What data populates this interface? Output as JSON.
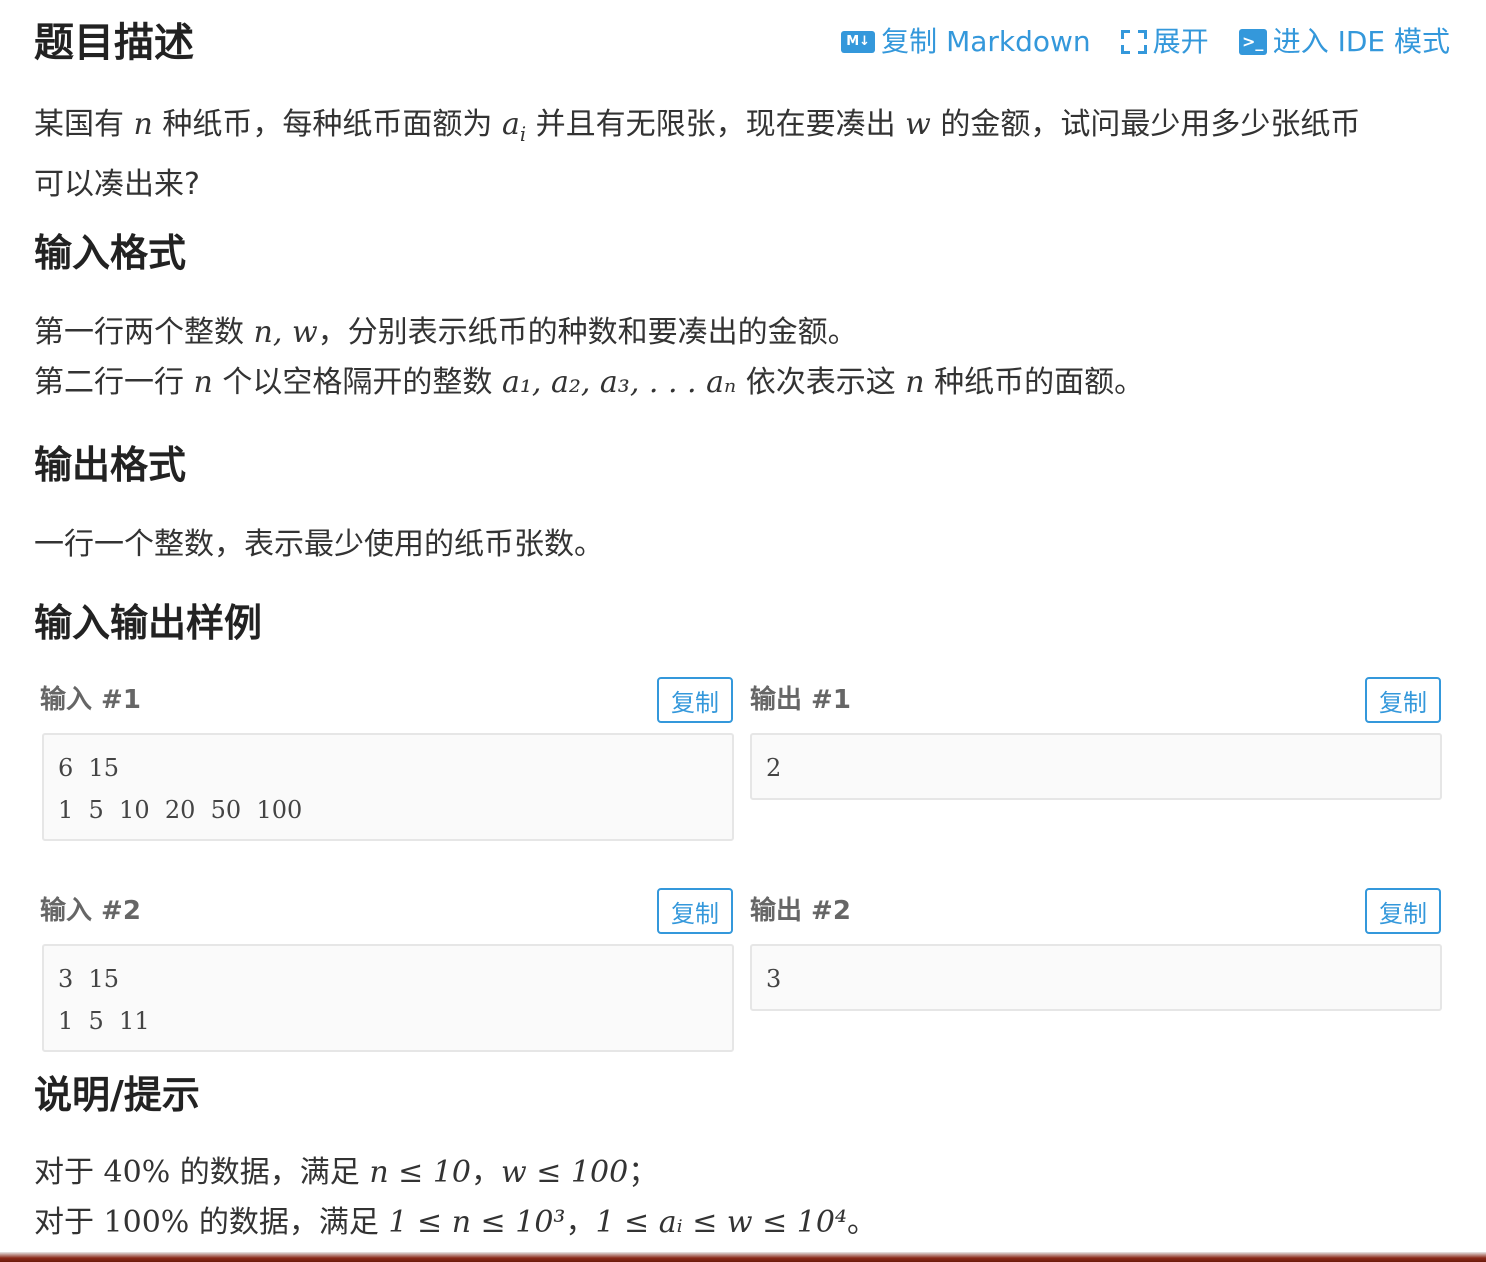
{
  "header": {
    "title": "题目描述",
    "actions": [
      {
        "icon": "markdown-icon",
        "label": "复制 Markdown"
      },
      {
        "icon": "expand-icon",
        "label": "展开"
      },
      {
        "icon": "terminal-icon",
        "label": "进入 IDE 模式"
      }
    ]
  },
  "description": {
    "p1_a": "某国有 ",
    "p1_n": "n",
    "p1_b": " 种纸币，每种纸币面额为 ",
    "p1_ai": "a",
    "p1_ai_sub": "i",
    "p1_c": " 并且有无限张，现在要凑出 ",
    "p1_w": "w",
    "p1_d": " 的金额，试问最少用多少张纸币",
    "p1_e": "可以凑出来?"
  },
  "input_format": {
    "heading": "输入格式",
    "l1_a": "第一行两个整数 ",
    "l1_math": "n, w",
    "l1_b": "，分别表示纸币的种数和要凑出的金额。",
    "l2_a": "第二行一行 ",
    "l2_n": "n",
    "l2_b": " 个以空格隔开的整数 ",
    "l2_seq": "a₁, a₂, a₃, . . . aₙ",
    "l2_c": " 依次表示这 ",
    "l2_n2": "n",
    "l2_d": " 种纸币的面额。"
  },
  "output_format": {
    "heading": "输出格式",
    "text": "一行一个整数，表示最少使用的纸币张数。"
  },
  "samples": {
    "heading": "输入输出样例",
    "copy_label": "复制",
    "items": [
      {
        "in_label": "输入 #1",
        "out_label": "输出 #1",
        "in_l1": "6  15",
        "in_l2": "1  5  10  20  50  100",
        "out": "2"
      },
      {
        "in_label": "输入 #2",
        "out_label": "输出 #2",
        "in_l1": "3  15",
        "in_l2": "1  5  11",
        "out": "3"
      }
    ]
  },
  "hint": {
    "heading": "说明/提示",
    "l1_a": "对于 ",
    "l1_pct": "40%",
    "l1_b": " 的数据，满足 ",
    "l1_m1": "n ≤ 10",
    "l1_c": "，",
    "l1_m2": "w ≤ 100",
    "l1_d": "；",
    "l2_a": "对于 ",
    "l2_pct": "100%",
    "l2_b": " 的数据，满足 ",
    "l2_m1": "1 ≤ n ≤ 10³",
    "l2_c": "，",
    "l2_m2": "1 ≤ aᵢ ≤ w ≤ 10⁴",
    "l2_d": "。"
  }
}
